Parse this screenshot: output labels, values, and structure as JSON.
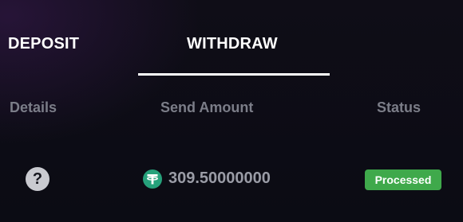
{
  "tabs": {
    "deposit": "DEPOSIT",
    "withdraw": "WITHDRAW",
    "active": "withdraw"
  },
  "columns": {
    "details": "Details",
    "send_amount": "Send Amount",
    "status": "Status"
  },
  "rows": [
    {
      "details_icon": "question-mark-icon",
      "currency_icon": "tether-icon",
      "amount": "309.50000000",
      "status": "Processed",
      "status_color": "#3fa94b"
    }
  ],
  "colors": {
    "background": "#0b0c14",
    "header_text": "#7b7d88",
    "tether_green": "#26a17b",
    "active_underline": "#ffffff"
  }
}
